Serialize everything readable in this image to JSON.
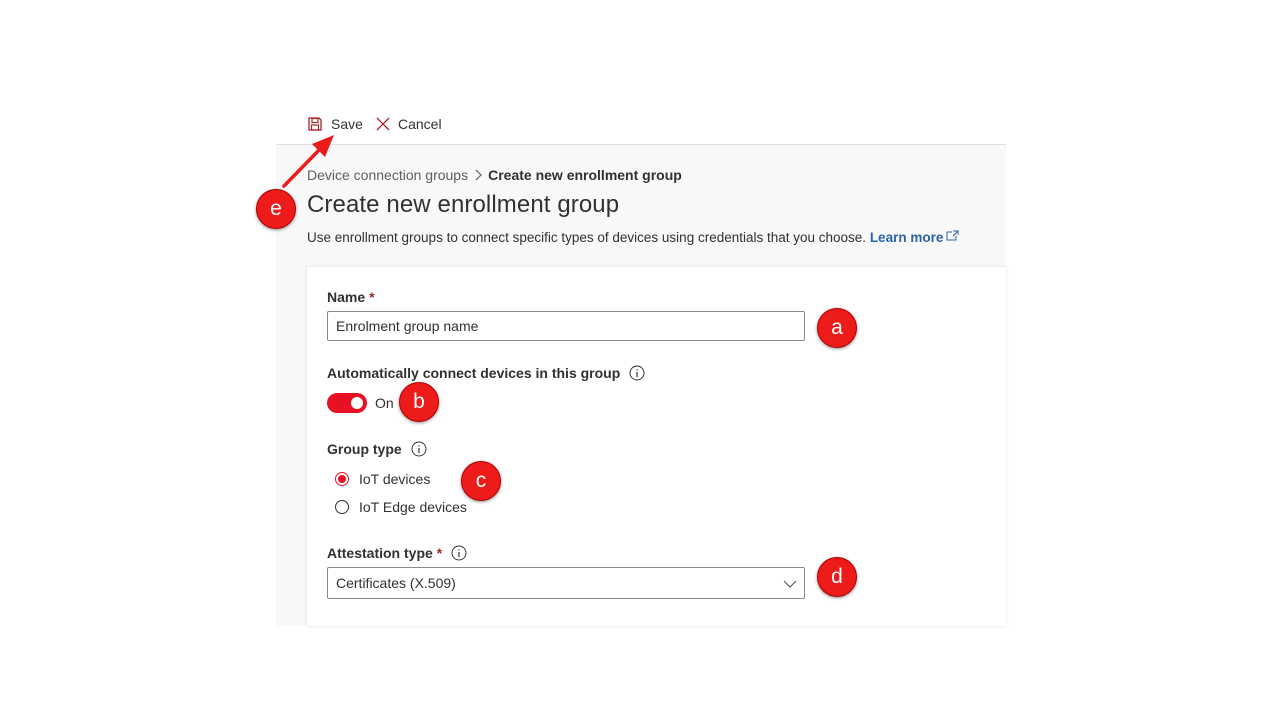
{
  "toolbar": {
    "save_label": "Save",
    "cancel_label": "Cancel"
  },
  "breadcrumb": {
    "parent": "Device connection groups",
    "current": "Create new enrollment group"
  },
  "page": {
    "title": "Create new enrollment group",
    "description": "Use enrollment groups to connect specific types of devices using credentials that you choose. ",
    "learn_more": "Learn more"
  },
  "form": {
    "name": {
      "label": "Name",
      "required": "*",
      "placeholder": "Enrolment group name"
    },
    "auto_connect": {
      "label": "Automatically connect devices in this group",
      "state": "On"
    },
    "group_type": {
      "label": "Group type",
      "options": [
        "IoT devices",
        "IoT Edge devices"
      ],
      "selected": "IoT devices"
    },
    "attestation": {
      "label": "Attestation type",
      "required": "*",
      "value": "Certificates (X.509)"
    }
  },
  "annotations": {
    "a": "a",
    "b": "b",
    "c": "c",
    "d": "d",
    "e": "e"
  },
  "colors": {
    "accent": "#e81123",
    "link": "#2b63a8",
    "badge": "#ee1b1b"
  }
}
